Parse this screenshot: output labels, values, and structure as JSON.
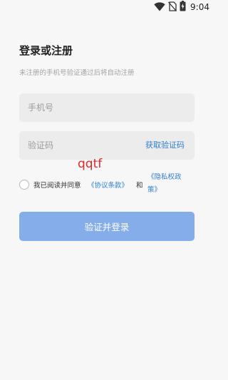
{
  "status_bar": {
    "time": "9:04",
    "icons": [
      "wifi-icon",
      "no-sim-icon",
      "battery-charging-icon"
    ]
  },
  "login": {
    "title": "登录或注册",
    "subtitle": "未注册的手机号验证通过后将自动注册",
    "phone": {
      "placeholder": "手机号",
      "value": ""
    },
    "code": {
      "placeholder": "验证码",
      "value": "",
      "get_code_label": "获取验证码"
    },
    "agreement": {
      "checked": false,
      "prefix": "我已阅读并同意",
      "protocol_link": "《协议条款》",
      "and": "和",
      "privacy_link": "《隐私权政策》"
    },
    "submit_label": "验证并登录"
  },
  "watermark": "qqtf",
  "colors": {
    "background": "#f7f7f7",
    "field_background": "#ececec",
    "link": "#2f7fcf",
    "button": "#84ade9",
    "watermark": "#e02828"
  }
}
